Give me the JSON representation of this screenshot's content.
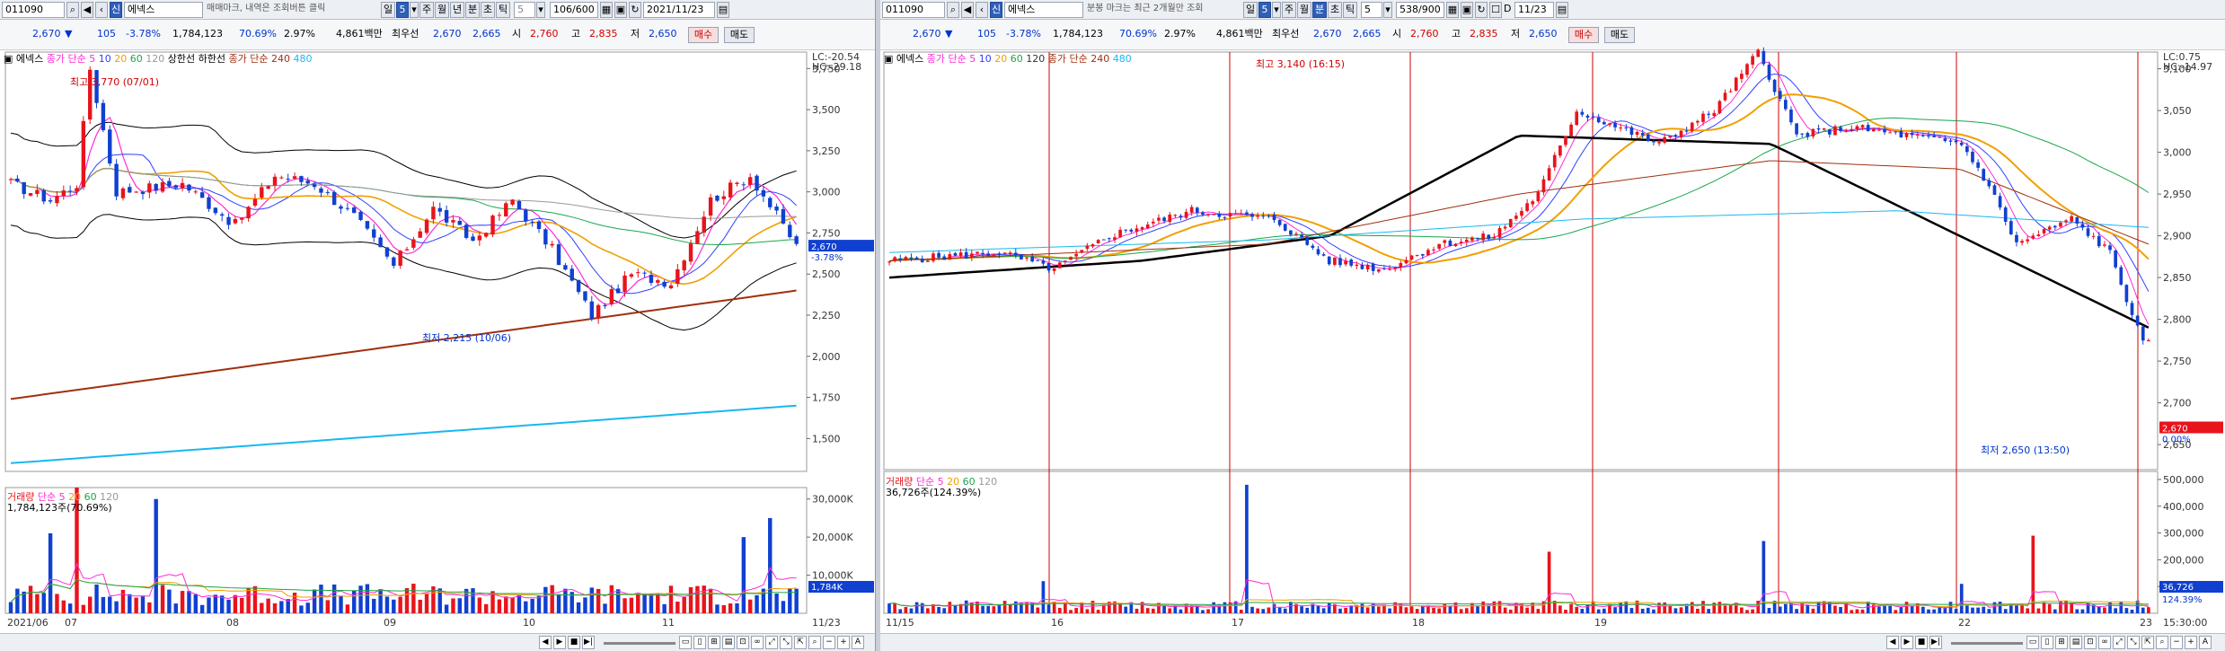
{
  "left": {
    "toolbar": {
      "code": "011090",
      "name": "에넥스",
      "notice": "매매마크, 내역은 조회버튼 클릭",
      "period_day": "일",
      "period_num": "5",
      "period_week": "주",
      "period_month": "월",
      "period_year": "년",
      "period_min": "분",
      "period_sec": "초",
      "period_tick": "틱",
      "interval": "5",
      "count": "106/600",
      "date": "2021/11/23"
    },
    "info": {
      "price": "2,670",
      "change": "105",
      "rate": "-3.78%",
      "volume": "1,784,123",
      "vol_rate": "70.69%",
      "turnover": "2.97%",
      "amount": "4,861백만",
      "rank_label": "최우선",
      "bid": "2,670",
      "ask": "2,665",
      "open_label": "시",
      "open": "2,760",
      "high_label": "고",
      "high": "2,835",
      "low_label": "저",
      "low": "2,650",
      "buy": "매수",
      "sell": "매도"
    },
    "price_legend": {
      "name": "에넥스",
      "ma_label": "종가 단순",
      "ma1": "5",
      "ma2": "10",
      "ma3": "20",
      "ma4": "60",
      "ma5": "120",
      "band": "상한선 하한선",
      "ma_label2": "종가 단순",
      "ma6": "240",
      "ma7": "480"
    },
    "top_right": {
      "lc": "LC:-20.54",
      "hc": "HC:-29.18"
    },
    "price_ticks": [
      "3,750",
      "3,500",
      "3,250",
      "3,000",
      "2,750",
      "2,500",
      "2,250",
      "2,000",
      "1,750",
      "1,500"
    ],
    "current_price": "2,670",
    "current_rate": "-3.78%",
    "high_annot": "최고 3,770 (07/01)",
    "low_annot": "최저 2,215 (10/06)",
    "volume_legend": {
      "label": "거래량",
      "ma_label": "단순",
      "v1": "5",
      "v2": "20",
      "v3": "60",
      "v4": "120",
      "value": "1,784,123주(70.69%)"
    },
    "volume_ticks": [
      "30,000K",
      "20,000K",
      "10,000K"
    ],
    "current_volume": "1,784K",
    "x_labels": [
      "2021/06",
      "07",
      "08",
      "09",
      "10",
      "11"
    ],
    "x_end": "11/23"
  },
  "right": {
    "toolbar": {
      "code": "011090",
      "name": "에넥스",
      "notice": "분봉 마크는 최근 2개월만 조회",
      "period_day": "일",
      "period_num": "5",
      "period_week": "주",
      "period_month": "월",
      "period_min": "분",
      "period_sec": "초",
      "period_tick": "틱",
      "interval": "5",
      "count": "538/900",
      "date": "11/23",
      "d_label": "D"
    },
    "info": {
      "price": "2,670",
      "change": "105",
      "rate": "-3.78%",
      "volume": "1,784,123",
      "vol_rate": "70.69%",
      "turnover": "2.97%",
      "amount": "4,861백만",
      "rank_label": "최우선",
      "bid": "2,670",
      "ask": "2,665",
      "open_label": "시",
      "open": "2,760",
      "high_label": "고",
      "high": "2,835",
      "low_label": "저",
      "low": "2,650",
      "buy": "매수",
      "sell": "매도"
    },
    "price_legend": {
      "name": "에넥스",
      "ma_label": "종가 단순",
      "ma1": "5",
      "ma2": "10",
      "ma3": "20",
      "ma4": "60",
      "ma5": "120",
      "ma_label2": "종가 단순",
      "ma6": "240",
      "ma7": "480"
    },
    "top_right": {
      "lc": "LC:0.75",
      "hc": "HC:-14.97"
    },
    "price_ticks": [
      "3,100",
      "3,050",
      "3,000",
      "2,950",
      "2,900",
      "2,850",
      "2,800",
      "2,750",
      "2,700",
      "2,650"
    ],
    "current_price": "2,670",
    "current_rate": "0.00%",
    "high_annot": "최고 3,140 (16:15)",
    "low_annot": "최저 2,650 (13:50)",
    "volume_legend": {
      "label": "거래량",
      "ma_label": "단순",
      "v1": "5",
      "v2": "20",
      "v3": "60",
      "v4": "120",
      "value": "36,726주(124.39%)"
    },
    "volume_ticks": [
      "500,000",
      "400,000",
      "300,000",
      "200,000",
      "100,000"
    ],
    "current_volume": "36,726",
    "current_volume_rate": "124.39%",
    "x_labels": [
      "11/15",
      "16",
      "17",
      "18",
      "19",
      "22",
      "23"
    ],
    "x_end": "15:30:00"
  },
  "colors": {
    "up": "#e8141c",
    "down": "#1040d0",
    "ma5": "#ff2bd6",
    "ma10": "#3040ff",
    "ma20": "#f0a000",
    "ma60": "#1aa64a",
    "ma120": "#999999",
    "ma240": "#a03010",
    "ma480": "#19b8ee",
    "band": "#000000"
  }
}
